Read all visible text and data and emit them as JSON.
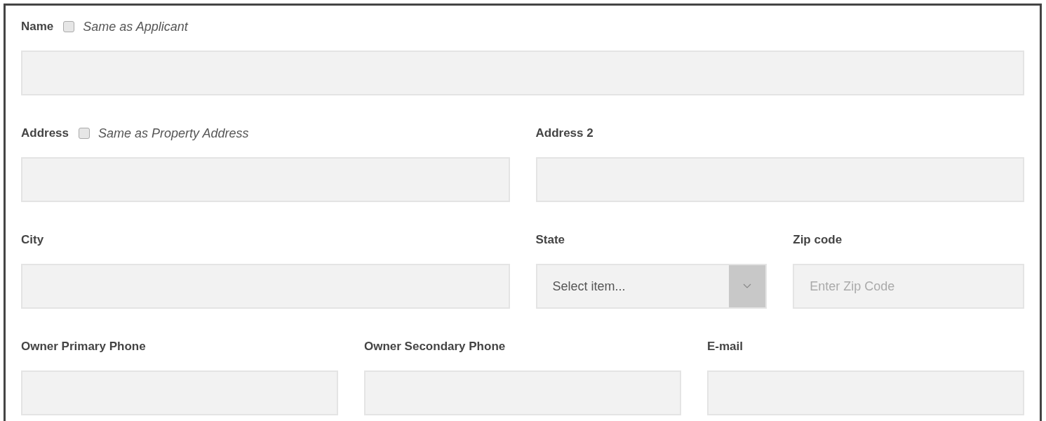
{
  "rows": [
    {
      "fields": [
        {
          "kind": "text",
          "label": "Name",
          "checkbox": {
            "label": "Same as Applicant",
            "checked": false
          }
        }
      ]
    },
    {
      "fields": [
        {
          "kind": "text",
          "label": "Address",
          "checkbox": {
            "label": "Same as Property Address",
            "checked": false
          }
        },
        {
          "kind": "text",
          "label": "Address 2"
        }
      ]
    },
    {
      "fields": [
        {
          "kind": "text",
          "label": "City"
        },
        {
          "kind": "select",
          "label": "State",
          "placeholder": "Select item..."
        },
        {
          "kind": "text",
          "label": "Zip code",
          "placeholder": "Enter Zip Code"
        }
      ]
    },
    {
      "fields": [
        {
          "kind": "text",
          "label": "Owner Primary Phone"
        },
        {
          "kind": "text",
          "label": "Owner Secondary Phone"
        },
        {
          "kind": "text",
          "label": "E-mail"
        }
      ]
    }
  ]
}
